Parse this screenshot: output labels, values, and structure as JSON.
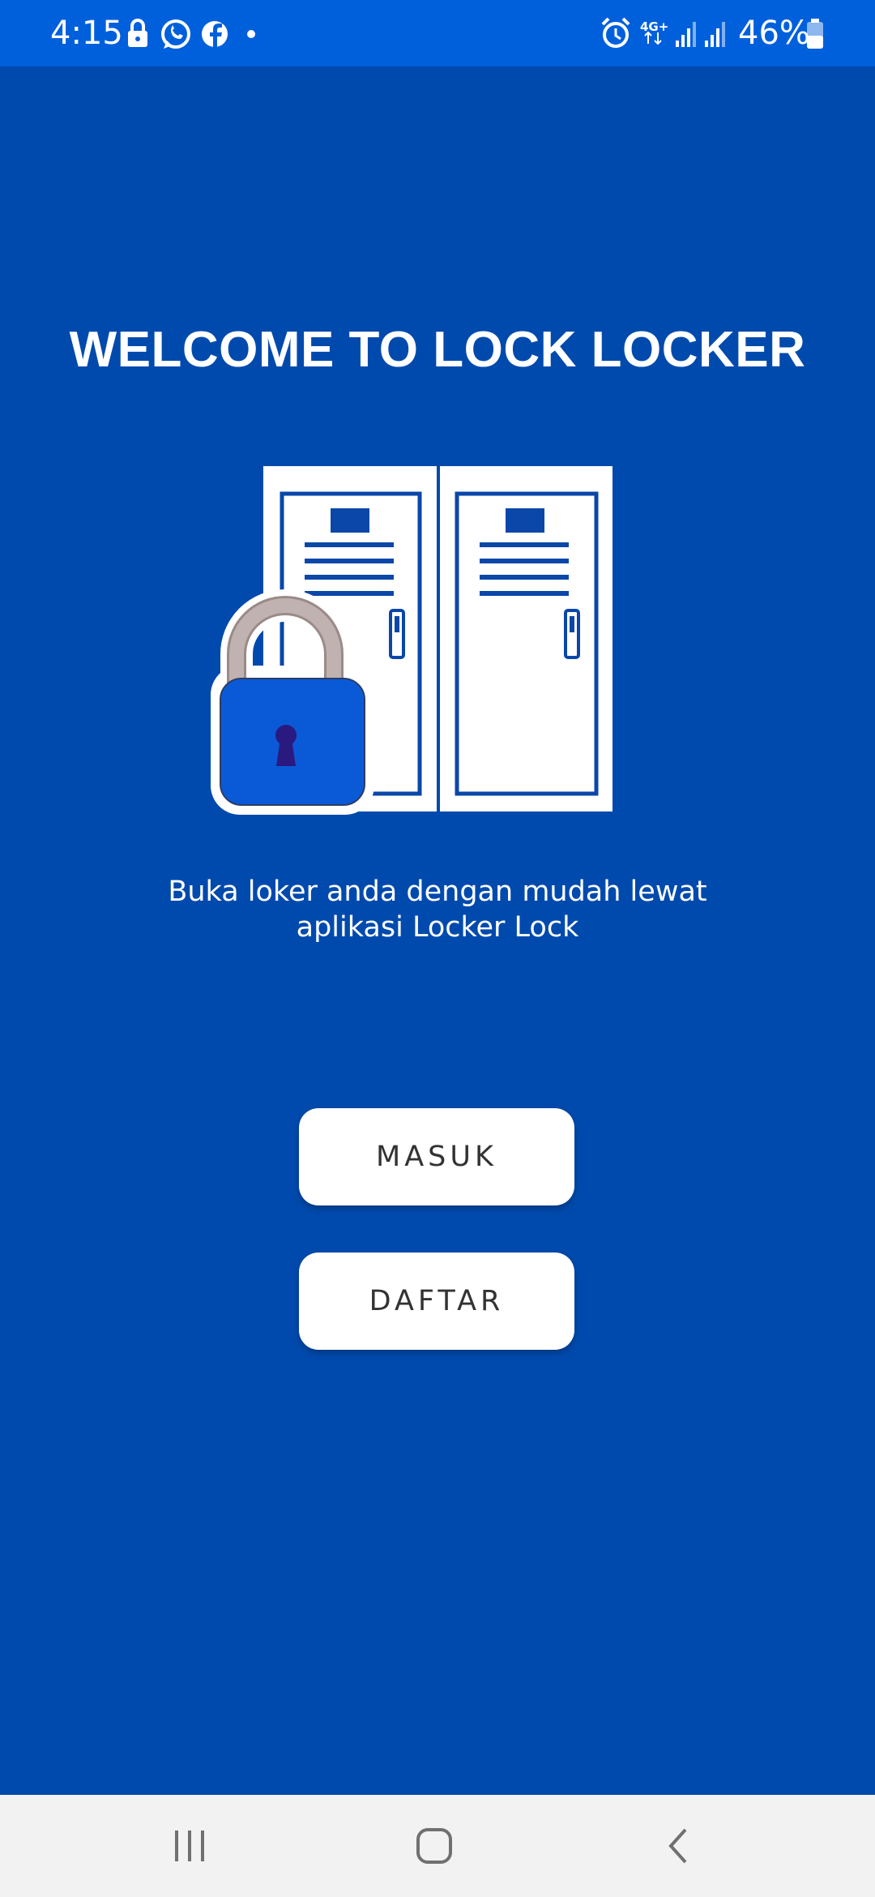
{
  "status_bar": {
    "time": "4:15",
    "battery_percent": "46%",
    "left_icons": [
      "lock-icon",
      "whatsapp-icon",
      "facebook-icon",
      "notification-dot-icon"
    ],
    "right_icons": [
      "alarm-icon",
      "4g-data-icon",
      "signal-1-icon",
      "signal-2-icon",
      "battery-icon"
    ],
    "network_label": "4G+",
    "background_color": "#0060dc"
  },
  "main": {
    "background_color": "#004aad",
    "title": "WELCOME TO LOCK LOCKER",
    "tagline_line1": "Buka loker anda dengan mudah lewat",
    "tagline_line2": "aplikasi Locker Lock",
    "illustration": [
      "locker-icon",
      "padlock-icon"
    ]
  },
  "buttons": {
    "masuk_label": "MASUK",
    "daftar_label": "DAFTAR"
  },
  "nav_bar": {
    "items": [
      "recent-apps-icon",
      "home-icon",
      "back-icon"
    ]
  }
}
